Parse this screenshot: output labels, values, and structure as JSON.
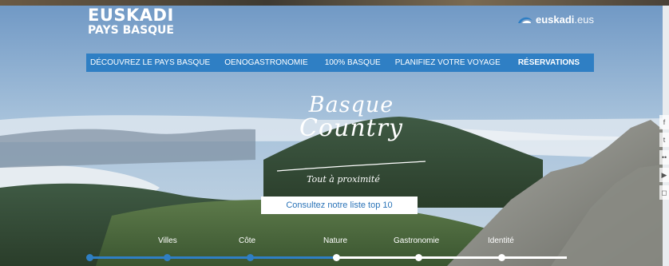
{
  "header": {
    "logo_line1": "EUSKADI",
    "logo_line2": "PAYS BASQUE",
    "brand_bold": "euskadi",
    "brand_light": ".eus"
  },
  "nav": {
    "items": [
      {
        "label": "DÉCOUVREZ LE PAYS BASQUE"
      },
      {
        "label": "OENOGASTRONOMIE"
      },
      {
        "label": "100% BASQUE"
      },
      {
        "label": "PLANIFIEZ VOTRE VOYAGE"
      },
      {
        "label": "RÉSERVATIONS"
      }
    ]
  },
  "hero": {
    "title_line1": "Basque",
    "title_line2": "Country",
    "tagline": "Tout à proximité",
    "cta_label": "Consultez notre liste top 10"
  },
  "timeline": {
    "labels": [
      "Villes",
      "Côte",
      "Nature",
      "Gastronomie",
      "Identité"
    ]
  },
  "colors": {
    "accent": "#2f7fc4",
    "text_on_dark": "#ffffff"
  },
  "social": [
    "facebook-icon",
    "twitter-icon",
    "flickr-icon",
    "youtube-icon",
    "instagram-icon"
  ]
}
